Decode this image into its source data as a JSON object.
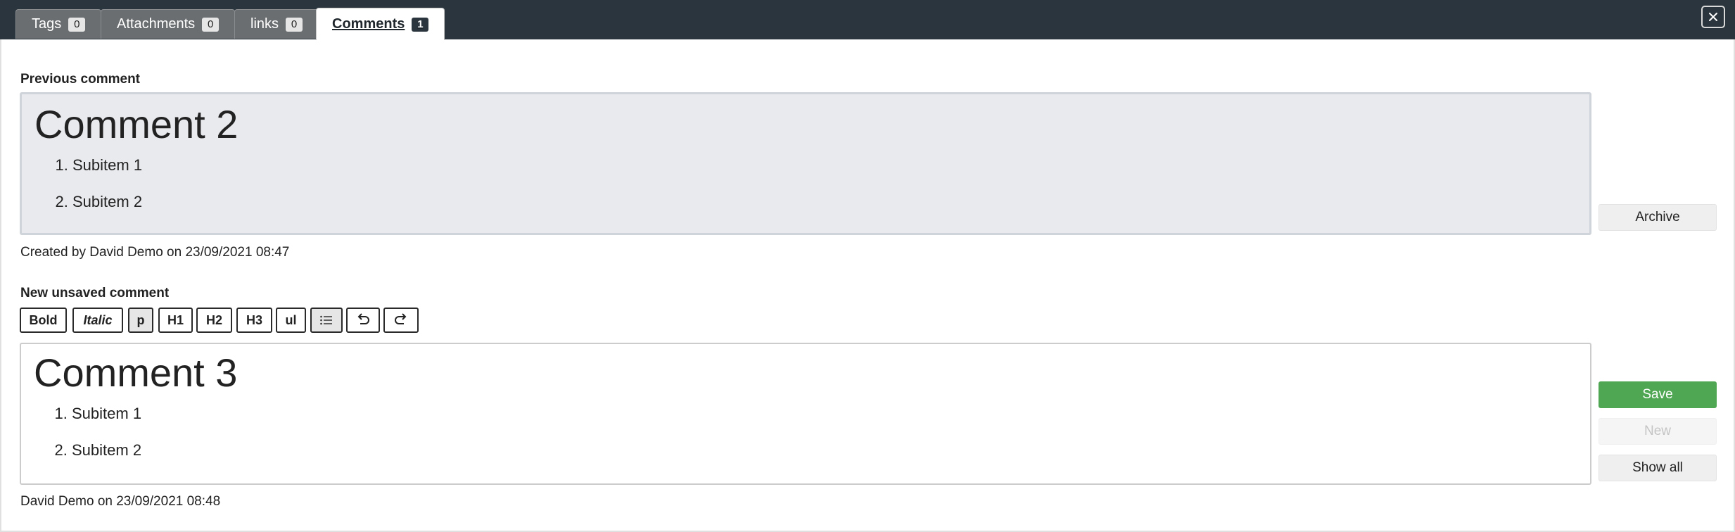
{
  "tabs": [
    {
      "label": "Tags",
      "count": "0"
    },
    {
      "label": "Attachments",
      "count": "0"
    },
    {
      "label": "links",
      "count": "0"
    },
    {
      "label": "Comments",
      "count": "1"
    }
  ],
  "close_icon": "close-icon",
  "previous": {
    "section_label": "Previous comment",
    "heading": "Comment 2",
    "items": [
      "Subitem 1",
      "Subitem 2"
    ],
    "meta": "Created by David Demo on 23/09/2021 08:47",
    "archive_label": "Archive"
  },
  "editor": {
    "section_label": "New unsaved comment",
    "toolbar": {
      "bold": "Bold",
      "italic": "Italic",
      "p": "p",
      "h1": "H1",
      "h2": "H2",
      "h3": "H3",
      "ul": "ul",
      "ol_icon": "ordered-list-icon",
      "undo_icon": "undo-icon",
      "redo_icon": "redo-icon"
    },
    "heading": "Comment 3",
    "items": [
      "Subitem 1",
      "Subitem 2"
    ],
    "meta": "David Demo on 23/09/2021 08:48",
    "save_label": "Save",
    "new_label": "New",
    "show_all_label": "Show all"
  },
  "colors": {
    "topbar": "#2b353d",
    "save": "#4fa653",
    "prev_box": "#e9eaee"
  }
}
